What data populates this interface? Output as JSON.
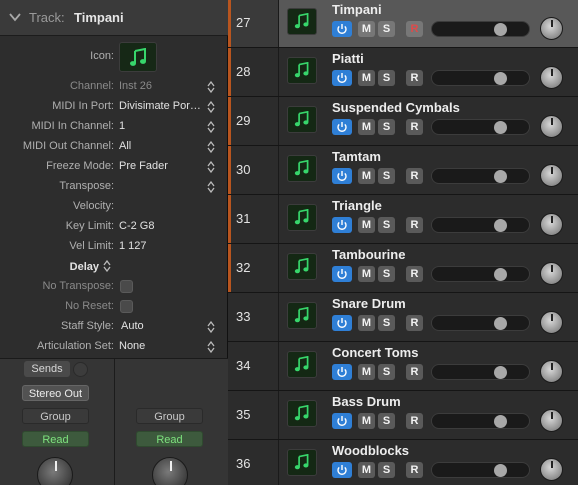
{
  "inspector": {
    "header_label": "Track:",
    "header_value": "Timpani",
    "icon_label": "Icon:",
    "icon": "music-note-icon",
    "params": [
      {
        "label": "Channel:",
        "value": "Inst 26",
        "dim": true
      },
      {
        "label": "MIDI In Port:",
        "value": "Divisimate Por…"
      },
      {
        "label": "MIDI In Channel:",
        "value": "1"
      },
      {
        "label": "MIDI Out Channel:",
        "value": "All"
      },
      {
        "label": "Freeze Mode:",
        "value": "Pre Fader"
      },
      {
        "label": "Transpose:",
        "value": ""
      },
      {
        "label": "Velocity:",
        "value": ""
      },
      {
        "label": "Key Limit:",
        "value": "C-2  G8"
      },
      {
        "label": "Vel Limit:",
        "value": "1  127"
      }
    ],
    "delay_label": "Delay",
    "no_transpose_label": "No Transpose:",
    "no_reset_label": "No Reset:",
    "staff_style_label": "Staff Style:",
    "staff_style_value": "Auto",
    "articulation_label": "Articulation Set:",
    "articulation_value": "None"
  },
  "strips": {
    "sends_label": "Sends",
    "output_label": "Stereo Out",
    "group_label": "Group",
    "automation_label": "Read"
  },
  "track_buttons": {
    "mute": "M",
    "solo": "S",
    "record": "R"
  },
  "tracks": [
    {
      "number": "27",
      "name": "Timpani",
      "selected": true,
      "armed": true,
      "accent": true
    },
    {
      "number": "28",
      "name": "Piatti",
      "selected": false,
      "armed": false,
      "accent": true
    },
    {
      "number": "29",
      "name": "Suspended Cymbals",
      "selected": false,
      "armed": false,
      "accent": true
    },
    {
      "number": "30",
      "name": "Tamtam",
      "selected": false,
      "armed": false,
      "accent": true
    },
    {
      "number": "31",
      "name": "Triangle",
      "selected": false,
      "armed": false,
      "accent": true
    },
    {
      "number": "32",
      "name": "Tambourine",
      "selected": false,
      "armed": false,
      "accent": true
    },
    {
      "number": "33",
      "name": "Snare Drum",
      "selected": false,
      "armed": false,
      "accent": false
    },
    {
      "number": "34",
      "name": "Concert Toms",
      "selected": false,
      "armed": false,
      "accent": false
    },
    {
      "number": "35",
      "name": "Bass Drum",
      "selected": false,
      "armed": false,
      "accent": false
    },
    {
      "number": "36",
      "name": "Woodblocks",
      "selected": false,
      "armed": false,
      "accent": false
    }
  ],
  "colors": {
    "accent": "#b8551f",
    "power_on": "#2f7fd6",
    "record_armed": "#e04a4a",
    "icon_green": "#37d66b"
  }
}
